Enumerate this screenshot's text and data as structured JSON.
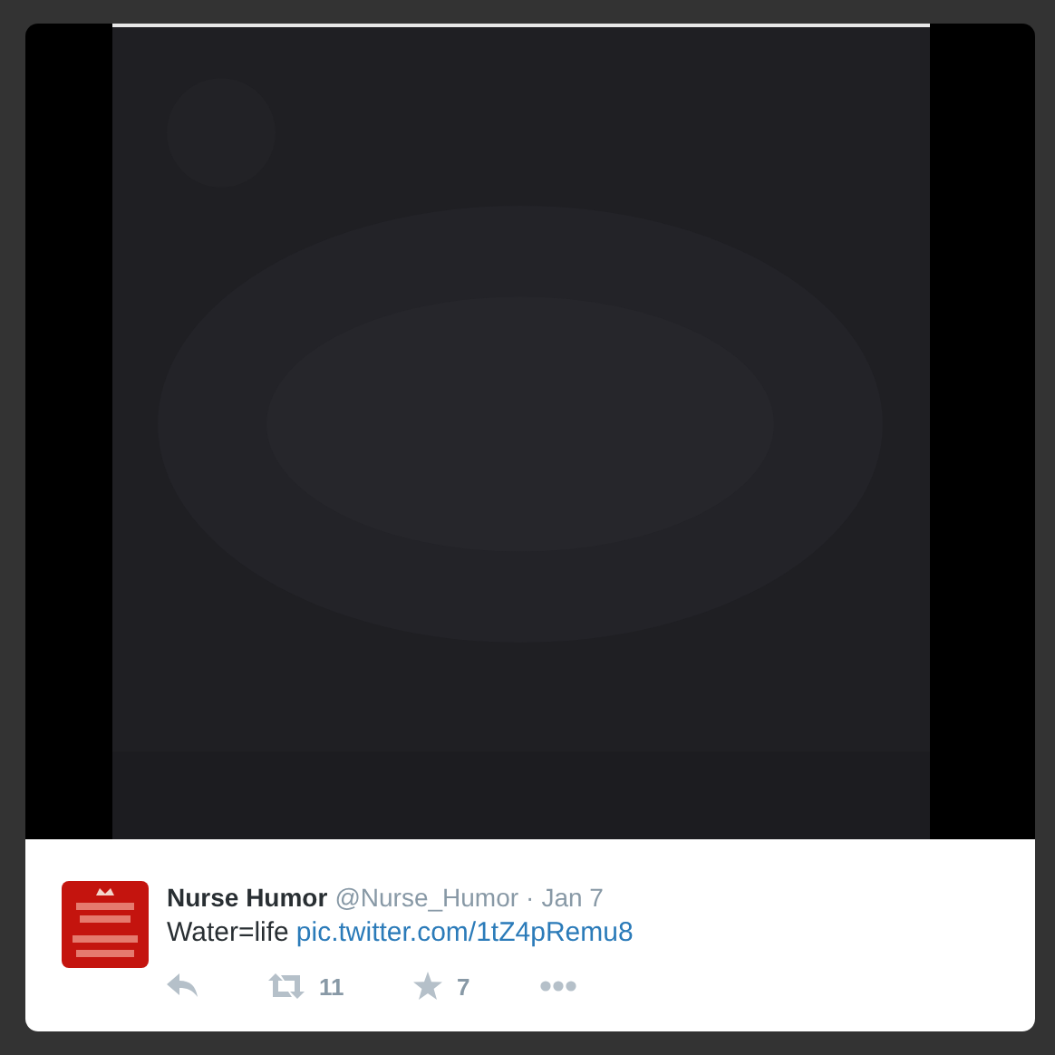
{
  "tweet": {
    "name": "Nurse Humor",
    "handle": "@Nurse_Humor",
    "separator": "·",
    "time": "Jan 7",
    "text": "Water=life",
    "link": "pic.twitter.com/1tZ4pRemu8",
    "actions": [
      {
        "kind": "reply"
      },
      {
        "kind": "retweet",
        "count": "11"
      },
      {
        "kind": "favorite",
        "count": "7"
      },
      {
        "kind": "more"
      }
    ]
  }
}
